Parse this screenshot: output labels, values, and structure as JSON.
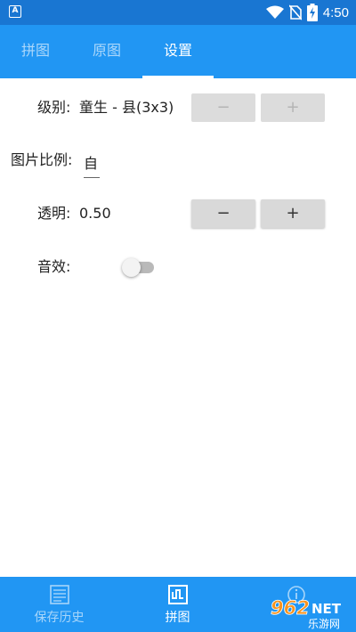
{
  "status_bar": {
    "app_badge": "A",
    "time": "4:50"
  },
  "top_tabs": [
    {
      "label": "拼图",
      "active": false
    },
    {
      "label": "原图",
      "active": false
    },
    {
      "label": "设置",
      "active": true
    }
  ],
  "settings": {
    "level": {
      "label": "级别:",
      "value": "童生 - 县(3x3)",
      "minus": "−",
      "plus": "+"
    },
    "ratio": {
      "label": "图片比例:",
      "value": "自"
    },
    "opacity": {
      "label": "透明:",
      "value": "0.50",
      "minus": "−",
      "plus": "+"
    },
    "sound": {
      "label": "音效:",
      "enabled": false
    }
  },
  "bottom_nav": [
    {
      "label": "保存历史",
      "icon": "history-icon",
      "active": false
    },
    {
      "label": "拼图",
      "icon": "puzzle-icon",
      "active": true
    },
    {
      "label": "",
      "icon": "info-icon",
      "active": false
    }
  ],
  "watermark": {
    "brand": "962",
    "brand_suffix": "NET",
    "site_name": "乐游网"
  },
  "colors": {
    "status_bar": "#1976d2",
    "app_bar": "#2196f3",
    "accent_text": "#ffffff"
  }
}
